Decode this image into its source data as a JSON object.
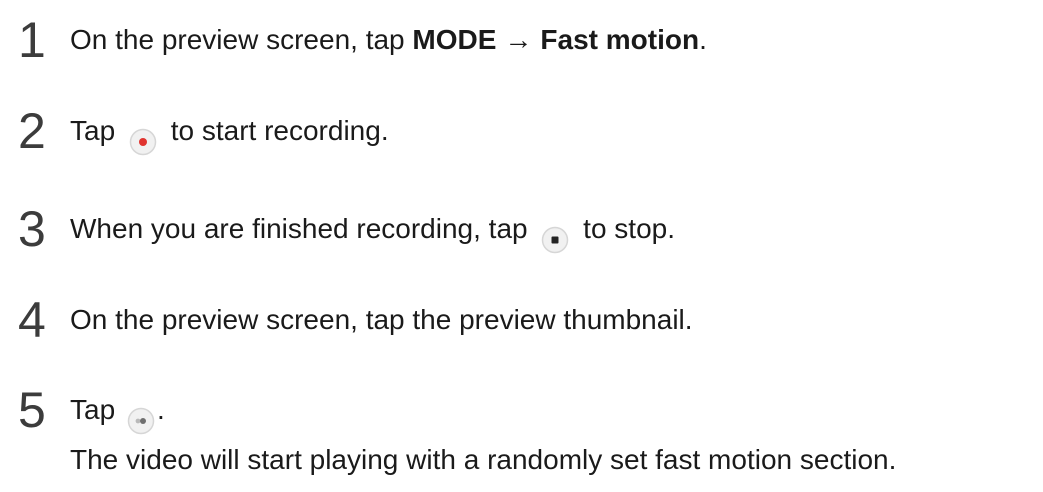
{
  "steps": [
    {
      "number": "1",
      "text_a": "On the preview screen, tap ",
      "bold_a": "MODE",
      "arrow": "→",
      "bold_b": "Fast motion",
      "text_b": "."
    },
    {
      "number": "2",
      "text_a": "Tap ",
      "icon": "record-button-icon",
      "text_b": " to start recording."
    },
    {
      "number": "3",
      "text_a": "When you are finished recording, tap ",
      "icon": "stop-button-icon",
      "text_b": " to stop."
    },
    {
      "number": "4",
      "text_a": "On the preview screen, tap the preview thumbnail."
    },
    {
      "number": "5",
      "text_a": "Tap ",
      "icon": "fast-motion-play-icon",
      "text_b": "."
    }
  ],
  "note": "The video will start playing with a randomly set fast motion section.",
  "colors": {
    "text": "#1a1a1a",
    "record_red": "#e0342f",
    "icon_bg": "#f1f1f1",
    "icon_border": "#d6d6d6"
  }
}
